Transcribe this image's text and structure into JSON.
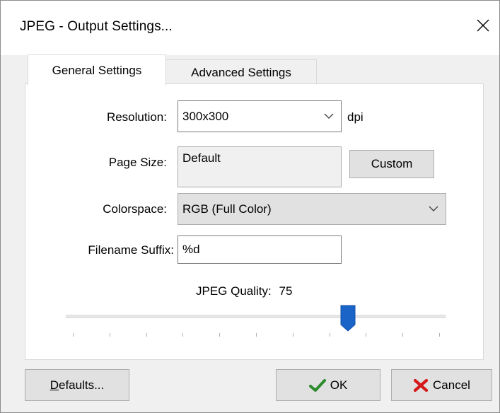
{
  "window": {
    "title": "JPEG - Output Settings..."
  },
  "tabs": [
    {
      "label": "General Settings",
      "selected": true
    },
    {
      "label": "Advanced Settings",
      "selected": false
    }
  ],
  "form": {
    "resolution": {
      "label": "Resolution:",
      "value": "300x300",
      "unit": "dpi"
    },
    "page_size": {
      "label": "Page Size:",
      "value": "Default",
      "button": "Custom"
    },
    "colorspace": {
      "label": "Colorspace:",
      "value": "RGB (Full Color)"
    },
    "filename_suffix": {
      "label": "Filename Suffix:",
      "value": "%d"
    },
    "quality": {
      "label": "JPEG Quality:",
      "value": "75",
      "min": 0,
      "max": 100
    }
  },
  "buttons": {
    "defaults_rest": "efaults...",
    "defaults_mnemonic": "D",
    "ok": "OK",
    "cancel": "Cancel"
  },
  "colors": {
    "ok_check": "#2e8b2e",
    "cancel_x": "#d41a1a",
    "slider_thumb": "#1a64c8"
  }
}
